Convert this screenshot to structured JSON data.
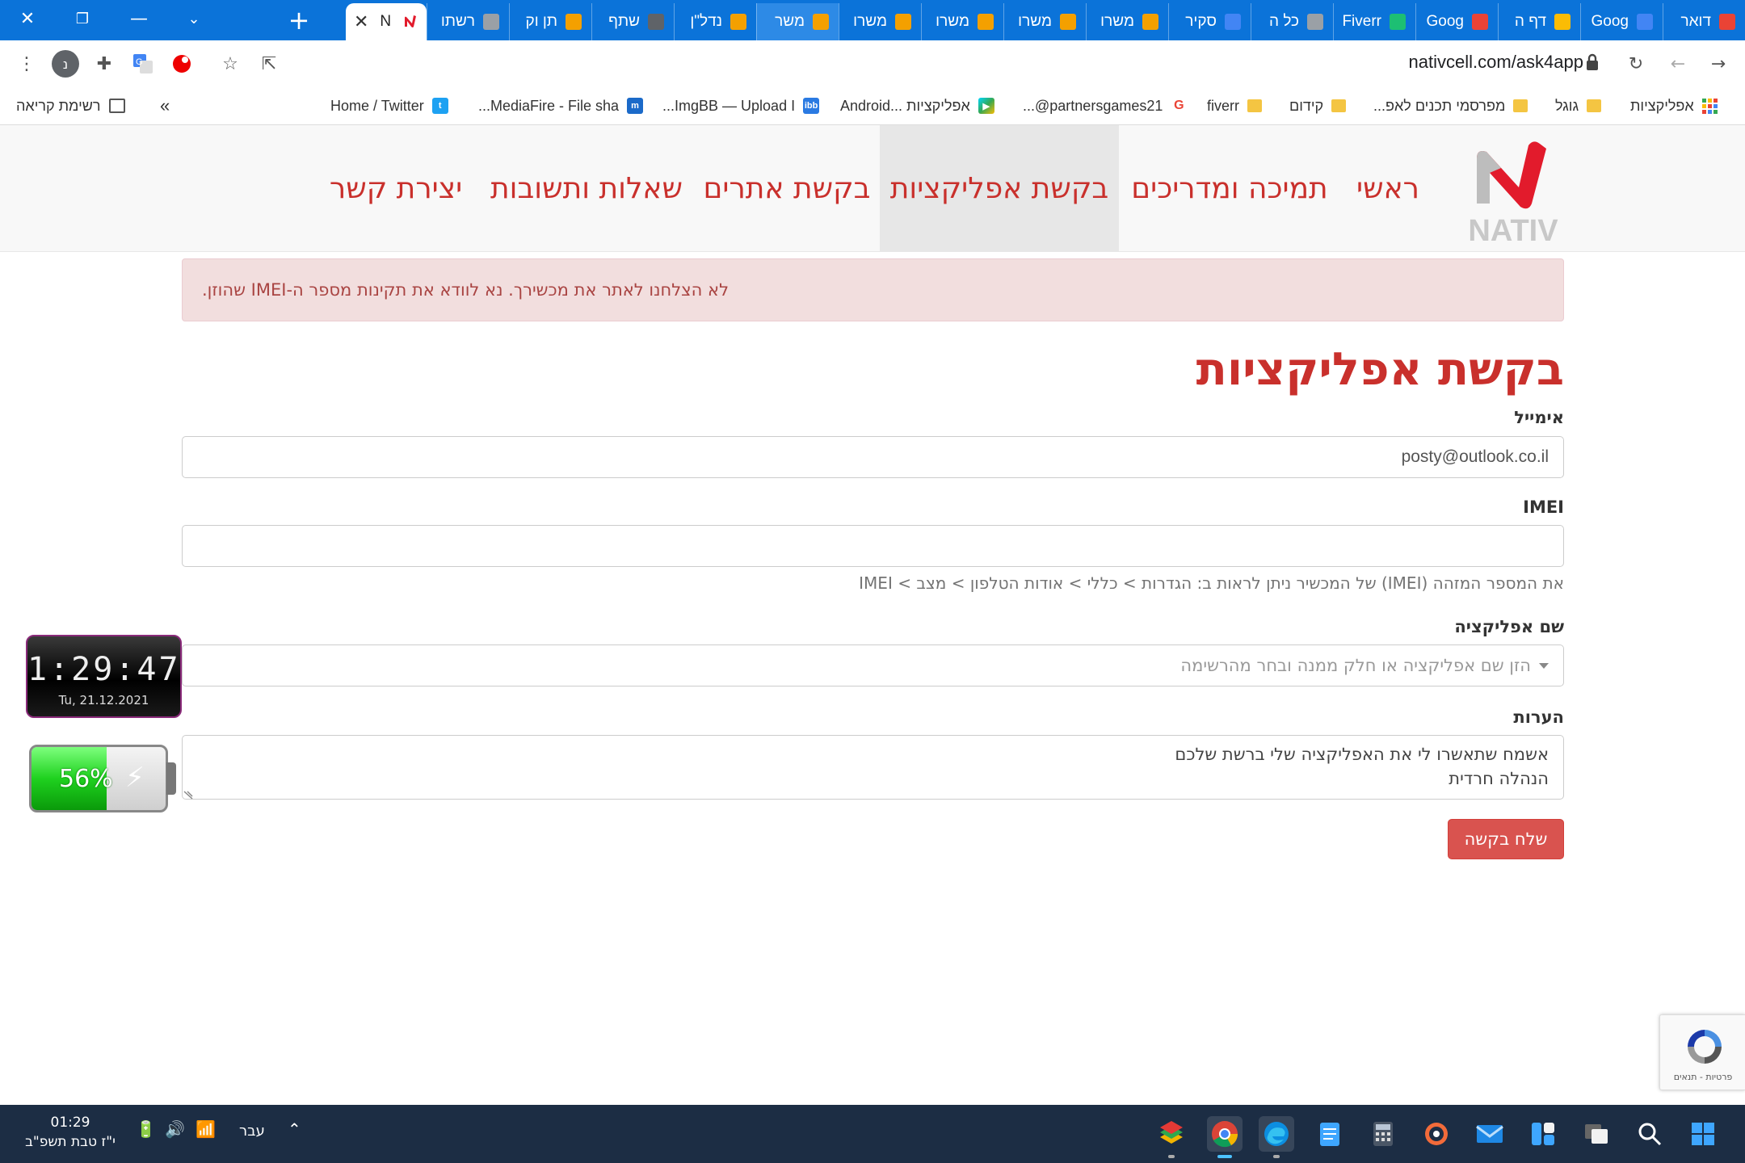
{
  "browser": {
    "active_tab_title": "N",
    "tabs": [
      {
        "title": "דואר",
        "favicon": "gmail-icon",
        "color": "#ea4335"
      },
      {
        "title": "Goog",
        "favicon": "translate-icon",
        "color": "#4285f4"
      },
      {
        "title": "דף ה",
        "favicon": "ads-icon",
        "color": "#fbbc04"
      },
      {
        "title": "Goog",
        "favicon": "chrome-icon",
        "color": "#ea4335"
      },
      {
        "title": "Fiverr",
        "favicon": "fiverr-icon",
        "color": "#1dbf73"
      },
      {
        "title": "כל ה",
        "favicon": "page-icon",
        "color": "#9aa0a6"
      },
      {
        "title": "סקיר",
        "favicon": "ads-icon",
        "color": "#4285f4"
      },
      {
        "title": "משרו",
        "favicon": "jobs-icon",
        "color": "#f4a000"
      },
      {
        "title": "משרו",
        "favicon": "jobs-icon",
        "color": "#f4a000"
      },
      {
        "title": "משרו",
        "favicon": "jobs-icon",
        "color": "#f4a000"
      },
      {
        "title": "משרו",
        "favicon": "jobs-icon",
        "color": "#f4a000"
      },
      {
        "title": "משר",
        "favicon": "jobs-icon",
        "color": "#f4a000"
      },
      {
        "title": "נדל\"ן",
        "favicon": "jobs-icon",
        "color": "#f4a000"
      },
      {
        "title": "שתף",
        "favicon": "share-icon",
        "color": "#5f6368"
      },
      {
        "title": "תן וק",
        "favicon": "cart-icon",
        "color": "#f4a000"
      },
      {
        "title": "רשתו",
        "favicon": "flower-icon",
        "color": "#9aa0a6"
      }
    ],
    "url": "nativcell.com/ask4app",
    "profile_letter": "נ",
    "bookmarks": [
      {
        "label": "אפליקציות",
        "icon": "apps-grid-icon"
      },
      {
        "label": "גוגל",
        "icon": "folder-icon"
      },
      {
        "label": "מפרסמי תכנים לאפ...",
        "icon": "folder-icon"
      },
      {
        "label": "קידום",
        "icon": "folder-icon"
      },
      {
        "label": "fiverr",
        "icon": "folder-icon"
      },
      {
        "label": "partnersgames21@...",
        "icon": "google-icon"
      },
      {
        "label": "אפליקציות ...Android",
        "icon": "play-store-icon"
      },
      {
        "label": "ImgBB — Upload I...",
        "icon": "imgbb-icon"
      },
      {
        "label": "MediaFire - File sha...",
        "icon": "mediafire-icon"
      },
      {
        "label": "Home / Twitter",
        "icon": "twitter-icon"
      }
    ],
    "reading_list": "רשימת קריאה",
    "more_bookmarks": "»"
  },
  "site": {
    "logo_text": "NATIV",
    "nav": [
      {
        "label": "ראשי"
      },
      {
        "label": "תמיכה ומדריכים"
      },
      {
        "label": "בקשת אפליקציות"
      },
      {
        "label": "בקשת אתרים"
      },
      {
        "label": "שאלות ותשובות"
      },
      {
        "label": "יצירת קשר"
      }
    ],
    "active_nav_index": 2,
    "alert": "לא הצלחנו לאתר את מכשירך. נא לוודא את תקינות מספר ה-IMEI שהוזן.",
    "page_title": "בקשת אפליקציות",
    "form": {
      "email_label": "אימייל",
      "email_value": "posty@outlook.co.il",
      "imei_label": "IMEI",
      "imei_value": "",
      "imei_help": "את המספר המזהה (IMEI) של המכשיר ניתן לראות ב: הגדרות > כללי > אודות הטלפון > מצב > IMEI",
      "app_label": "שם אפליקציה",
      "app_placeholder": "הזן שם אפליקציה או חלק ממנה ובחר מהרשימה",
      "notes_label": "הערות",
      "notes_line1": "אשמח שתאשרו לי את האפליקציה שלי ברשת שלכם",
      "notes_line2": "הנהלה חרדית",
      "submit_label": "שלח בקשה"
    },
    "recaptcha_text": "פרטיות - תנאים"
  },
  "widgets": {
    "clock_time": "1:29:47",
    "clock_date": "Tu, 21.12.2021",
    "battery_percent_label": "56%",
    "battery_level": 0.56
  },
  "taskbar": {
    "time": "01:29",
    "date": "י\"ז טבת תשפ\"ב",
    "language": "עבר"
  }
}
